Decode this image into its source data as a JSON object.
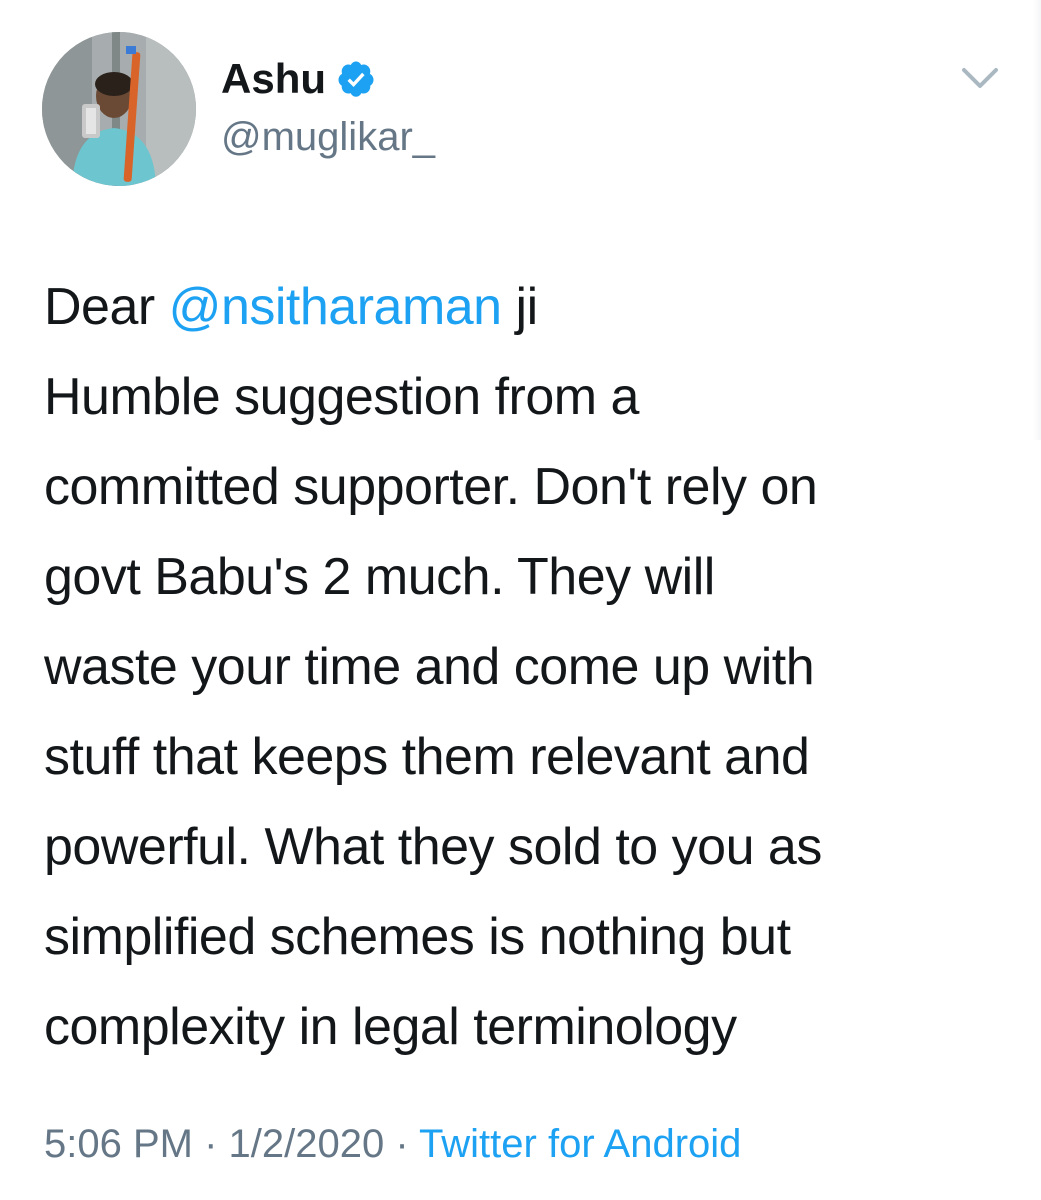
{
  "author": {
    "display_name": "Ashu",
    "handle": "@muglikar_",
    "verified": true,
    "avatar_icon": "profile-photo"
  },
  "tweet": {
    "line1": {
      "prefix": "Dear ",
      "mention": "@nsitharaman",
      "suffix": " ji"
    },
    "lines": [
      "Humble suggestion from a",
      "committed supporter. Don't rely on",
      "govt Babu's 2 much. They will",
      "waste your time and come up with",
      "stuff that keeps them relevant and",
      "powerful. What they sold to you as",
      "simplified schemes is nothing but",
      "complexity in legal terminology"
    ]
  },
  "meta": {
    "time": "5:06 PM",
    "separator1": " · ",
    "date": "1/2/2020",
    "separator2": " · ",
    "source": "Twitter for Android"
  },
  "colors": {
    "link": "#1da1f2",
    "text": "#14171a",
    "secondary": "#657786"
  },
  "icons": {
    "menu": "chevron-down-icon",
    "verified": "verified-badge-icon"
  }
}
